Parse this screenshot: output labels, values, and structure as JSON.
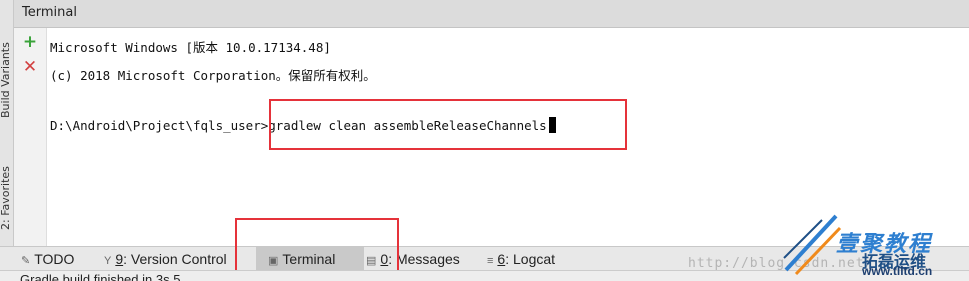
{
  "window": {
    "title": "Terminal"
  },
  "left_strip": {
    "tab1": "Build Variants",
    "tab2": "2: Favorites"
  },
  "terminal": {
    "lines": [
      "Microsoft Windows [版本 10.0.17134.48]",
      "(c) 2018 Microsoft Corporation。保留所有权利。",
      "D:\\Android\\Project\\fqls_user>gradlew clean assembleReleaseChannels"
    ]
  },
  "toolbar": {
    "add_icon": "plus-icon",
    "close_icon": "close-icon"
  },
  "bottom_tabs": [
    {
      "icon": "todo-icon",
      "mnemonic": "",
      "label": "TODO"
    },
    {
      "icon": "version-control-icon",
      "mnemonic": "9",
      "label": ": Version Control"
    },
    {
      "icon": "terminal-icon",
      "mnemonic": "",
      "label": "Terminal"
    },
    {
      "icon": "messages-icon",
      "mnemonic": "0",
      "label": ": Messages"
    },
    {
      "icon": "logcat-icon",
      "mnemonic": "6",
      "label": ": Logcat"
    }
  ],
  "status": {
    "text": "Gradle build finished in 3s 5"
  },
  "watermark": {
    "url": "http://blog.csdn.net/",
    "brand": "壹聚教程",
    "brand2": "拓磊运维",
    "site": "www.tlltd.cn"
  },
  "colors": {
    "highlight": "#e5323a",
    "add": "#3aa33a",
    "close": "#d24040"
  }
}
